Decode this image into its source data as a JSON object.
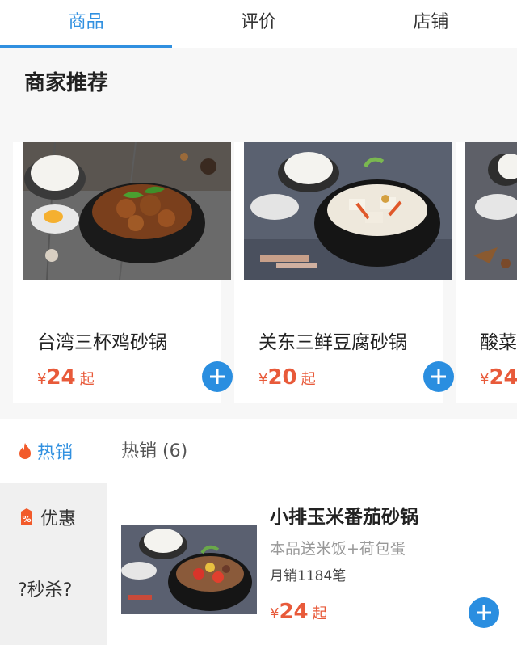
{
  "tabs": [
    {
      "label": "商品"
    },
    {
      "label": "评价"
    },
    {
      "label": "店铺"
    }
  ],
  "recommend": {
    "title": "商家推荐",
    "cards": [
      {
        "name": "台湾三杯鸡砂锅",
        "currency": "¥",
        "price": "24",
        "suffix": "起"
      },
      {
        "name": "关东三鲜豆腐砂锅",
        "currency": "¥",
        "price": "20",
        "suffix": "起"
      },
      {
        "name": "酸菜",
        "currency": "¥",
        "price": "24",
        "suffix": ""
      }
    ]
  },
  "sidebar": {
    "items": [
      {
        "label": "热销",
        "icon": "flame-icon"
      },
      {
        "label": "优惠",
        "icon": "discount-tag-icon"
      },
      {
        "label": "?秒杀?"
      }
    ]
  },
  "category": {
    "header": "热销 (6)"
  },
  "item": {
    "name": "小排玉米番茄砂锅",
    "desc": "本品送米饭+荷包蛋",
    "sales": "月销1184笔",
    "currency": "¥",
    "price": "24",
    "suffix": "起"
  },
  "colors": {
    "accent": "#3090e0",
    "price": "#e85a3a",
    "button": "#2a8ee0"
  }
}
